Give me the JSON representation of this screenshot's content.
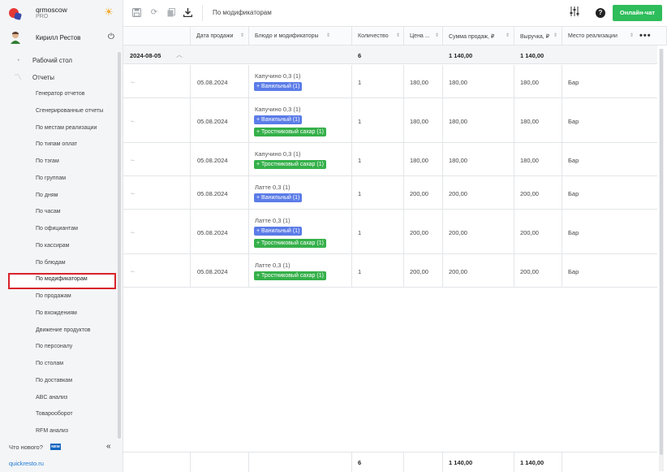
{
  "brand": {
    "name": "qrmoscow",
    "plan": "PRO"
  },
  "user": {
    "name": "Кирилл Рестов"
  },
  "nav": {
    "top_items": [
      {
        "label": "Рабочий стол",
        "icon": "dashboard-icon"
      },
      {
        "label": "Отчеты",
        "icon": "reports-icon"
      }
    ],
    "report_items": [
      "Генератор отчетов",
      "Сгенерированные отчеты",
      "По местам реализации",
      "По типам оплат",
      "По тэгам",
      "По группам",
      "По дням",
      "По часам",
      "По официантам",
      "По кассирам",
      "По блюдам",
      "По модификаторам",
      "По продажам",
      "По вхождениям",
      "Движение продуктов",
      "По персоналу",
      "По столам",
      "По доставкам",
      "ABC анализ",
      "Товарооборот",
      "RFM анализ"
    ],
    "active_item": "По модификаторам"
  },
  "whats_new": {
    "label": "Что нового?",
    "badge": "NEW"
  },
  "footer": {
    "link": "quickresto.ru"
  },
  "topbar": {
    "title": "По модификаторам",
    "chat_button": "Онлайн-чат"
  },
  "table": {
    "columns": [
      {
        "key": "link",
        "label": ""
      },
      {
        "key": "date",
        "label": "Дата продажи"
      },
      {
        "key": "dish",
        "label": "Блюдо и модификаторы"
      },
      {
        "key": "qty",
        "label": "Количество"
      },
      {
        "key": "price",
        "label": "Цена ..."
      },
      {
        "key": "sum",
        "label": "Сумма продаж, ₽"
      },
      {
        "key": "revenue",
        "label": "Выручка, ₽"
      },
      {
        "key": "place",
        "label": "Место реализации"
      }
    ],
    "group": {
      "date": "2024-08-05",
      "qty": "6",
      "sum": "1 140,00",
      "revenue": "1 140,00"
    },
    "rows": [
      {
        "date": "05.08.2024",
        "dish": "Капучино 0,3 (1)",
        "mods": [
          {
            "label": "+ Ванильный (1)",
            "color": "#5b7ce8"
          }
        ],
        "qty": "1",
        "price": "180,00",
        "sum": "180,00",
        "revenue": "180,00",
        "place": "Бар"
      },
      {
        "date": "05.08.2024",
        "dish": "Капучино 0,3 (1)",
        "mods": [
          {
            "label": "+ Ванильный (1)",
            "color": "#5b7ce8"
          },
          {
            "label": "+ Тростниковый сахар (1)",
            "color": "#35b04a"
          }
        ],
        "qty": "1",
        "price": "180,00",
        "sum": "180,00",
        "revenue": "180,00",
        "place": "Бар"
      },
      {
        "date": "05.08.2024",
        "dish": "Капучино 0,3 (1)",
        "mods": [
          {
            "label": "+ Тростниковый сахар (1)",
            "color": "#35b04a"
          }
        ],
        "qty": "1",
        "price": "180,00",
        "sum": "180,00",
        "revenue": "180,00",
        "place": "Бар"
      },
      {
        "date": "05.08.2024",
        "dish": "Латте 0,3 (1)",
        "mods": [
          {
            "label": "+ Ванильный (1)",
            "color": "#5b7ce8"
          }
        ],
        "qty": "1",
        "price": "200,00",
        "sum": "200,00",
        "revenue": "200,00",
        "place": "Бар"
      },
      {
        "date": "05.08.2024",
        "dish": "Латте 0,3 (1)",
        "mods": [
          {
            "label": "+ Ванильный (1)",
            "color": "#5b7ce8"
          },
          {
            "label": "+ Тростниковый сахар (1)",
            "color": "#35b04a"
          }
        ],
        "qty": "1",
        "price": "200,00",
        "sum": "200,00",
        "revenue": "200,00",
        "place": "Бар"
      },
      {
        "date": "05.08.2024",
        "dish": "Латте 0,3 (1)",
        "mods": [
          {
            "label": "+ Тростниковый сахар (1)",
            "color": "#35b04a"
          }
        ],
        "qty": "1",
        "price": "200,00",
        "sum": "200,00",
        "revenue": "200,00",
        "place": "Бар"
      }
    ],
    "totals": {
      "qty": "6",
      "sum": "1 140,00",
      "revenue": "1 140,00"
    }
  },
  "colors": {
    "accent_green": "#2ebd5b",
    "active_border": "#d8232a",
    "mod_blue": "#5b7ce8",
    "mod_green": "#35b04a",
    "link": "#1976d2"
  }
}
